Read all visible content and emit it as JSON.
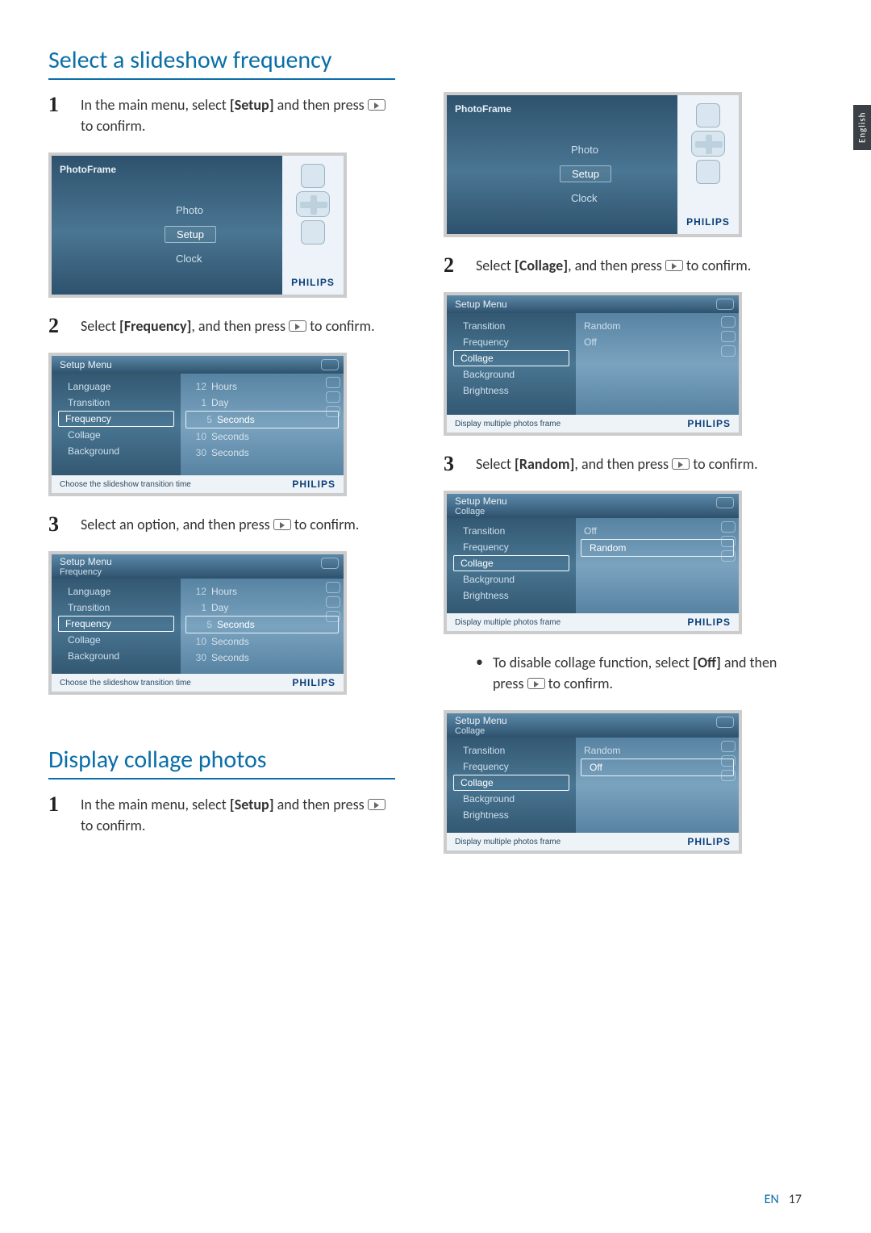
{
  "langtab": "English",
  "footer": {
    "lang": "EN",
    "page": "17"
  },
  "section_a": {
    "title": "Select a slideshow frequency",
    "steps": [
      {
        "n": "1",
        "pre": "In the main menu, select ",
        "bold": "[Setup]",
        "post": " and then press ",
        "tail": " to confirm."
      },
      {
        "n": "2",
        "pre": "Select ",
        "bold": "[Frequency]",
        "post": ", and then press ",
        "tail": " to confirm."
      },
      {
        "n": "3",
        "pre": "Select an option, and then press ",
        "bold": "",
        "post": "",
        "tail": " to confirm."
      }
    ]
  },
  "section_b": {
    "title": "Display collage photos",
    "steps": [
      {
        "n": "1",
        "pre": "In the main menu, select ",
        "bold": "[Setup]",
        "post": " and then press ",
        "tail": " to confirm."
      },
      {
        "n": "2",
        "pre": "Select ",
        "bold": "[Collage]",
        "post": ", and then press ",
        "tail": " to confirm."
      },
      {
        "n": "3",
        "pre": "Select ",
        "bold": "[Random]",
        "post": ", and then press ",
        "tail": " to confirm."
      }
    ],
    "bullet": {
      "pre": "To disable collage function, select ",
      "bold": "[Off]",
      "post": " and then press ",
      "tail": " to confirm."
    }
  },
  "brand": "PHILIPS",
  "main_menu": {
    "title": "PhotoFrame",
    "items": [
      "Photo",
      "Setup",
      "Clock"
    ],
    "selected": "Setup"
  },
  "freq_menu": {
    "title": "Setup Menu",
    "hint": "Choose the slideshow transition time",
    "left": [
      "Language",
      "Transition",
      "Frequency",
      "Collage",
      "Background"
    ],
    "right": [
      {
        "n": "12",
        "label": "Hours"
      },
      {
        "n": "1",
        "label": "Day"
      },
      {
        "n": "5",
        "label": "Seconds"
      },
      {
        "n": "10",
        "label": "Seconds"
      },
      {
        "n": "30",
        "label": "Seconds"
      }
    ],
    "left_sel": "Frequency",
    "right_sel_idx": 2
  },
  "freq_menu_sub": {
    "title": "Setup Menu",
    "sub": "Frequency",
    "hint": "Choose the slideshow transition time",
    "left": [
      "Language",
      "Transition",
      "Frequency",
      "Collage",
      "Background"
    ],
    "right": [
      {
        "n": "12",
        "label": "Hours"
      },
      {
        "n": "1",
        "label": "Day"
      },
      {
        "n": "5",
        "label": "Seconds"
      },
      {
        "n": "10",
        "label": "Seconds"
      },
      {
        "n": "30",
        "label": "Seconds"
      }
    ],
    "left_sel": "Frequency",
    "right_sel_idx": 2
  },
  "collage_a": {
    "title": "Setup Menu",
    "hint": "Display multiple photos frame",
    "left": [
      "Transition",
      "Frequency",
      "Collage",
      "Background",
      "Brightness"
    ],
    "right": [
      "Random",
      "Off"
    ],
    "left_sel": "Collage",
    "right_sel_idx": -1
  },
  "collage_b": {
    "title": "Setup Menu",
    "sub": "Collage",
    "hint": "Display multiple photos frame",
    "left": [
      "Transition",
      "Frequency",
      "Collage",
      "Background",
      "Brightness"
    ],
    "right": [
      "Off",
      "Random"
    ],
    "left_sel": "Collage",
    "right_sel_idx": 1
  },
  "collage_c": {
    "title": "Setup Menu",
    "sub": "Collage",
    "hint": "Display multiple photos frame",
    "left": [
      "Transition",
      "Frequency",
      "Collage",
      "Background",
      "Brightness"
    ],
    "right": [
      "Random",
      "Off"
    ],
    "left_sel": "Collage",
    "right_sel_idx": 1
  }
}
